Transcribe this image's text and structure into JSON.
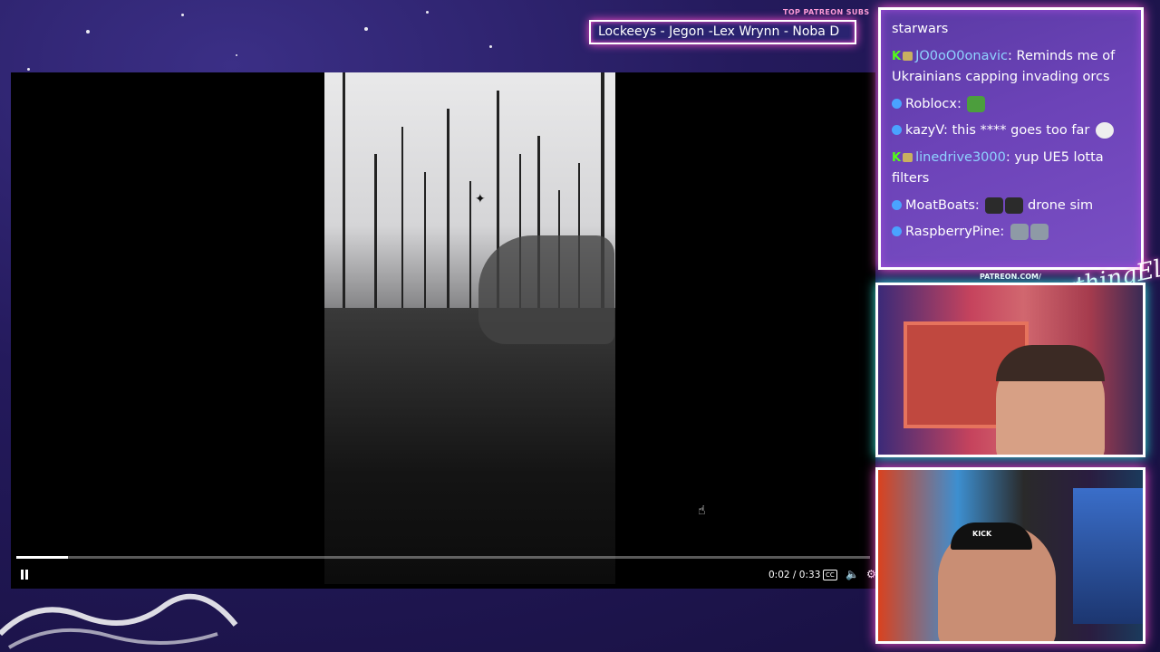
{
  "patreon": {
    "title": "TOP PATREON SUBS",
    "names": "Lockeeys - Jegon -Lex Wrynn -  Noba D"
  },
  "player": {
    "progress": 0.06,
    "time": "0:02 / 0:33",
    "cc_label": "CC"
  },
  "chat": {
    "top_line": "starwars",
    "messages": [
      {
        "user": "JO0oO0onavic",
        "text": "Reminds me of Ukrainians capping invading orcs"
      },
      {
        "user": "Roblocx",
        "text": ""
      },
      {
        "user": "kazyV",
        "text": "this **** goes too far"
      },
      {
        "user": "linedrive3000",
        "text": "yup UE5 lotta filters"
      },
      {
        "user": "MoatBoats",
        "text": "drone sim"
      },
      {
        "user": "RaspberryPine",
        "text": ""
      }
    ]
  },
  "overlay": {
    "patreon_url": "PATREON.COM/",
    "brand": "AnythingElse",
    "cap_text": "KICK"
  },
  "colors": {
    "accent_pink": "#ff4fd0",
    "accent_teal": "#2fe3d6",
    "kick_green": "#53fc18"
  }
}
